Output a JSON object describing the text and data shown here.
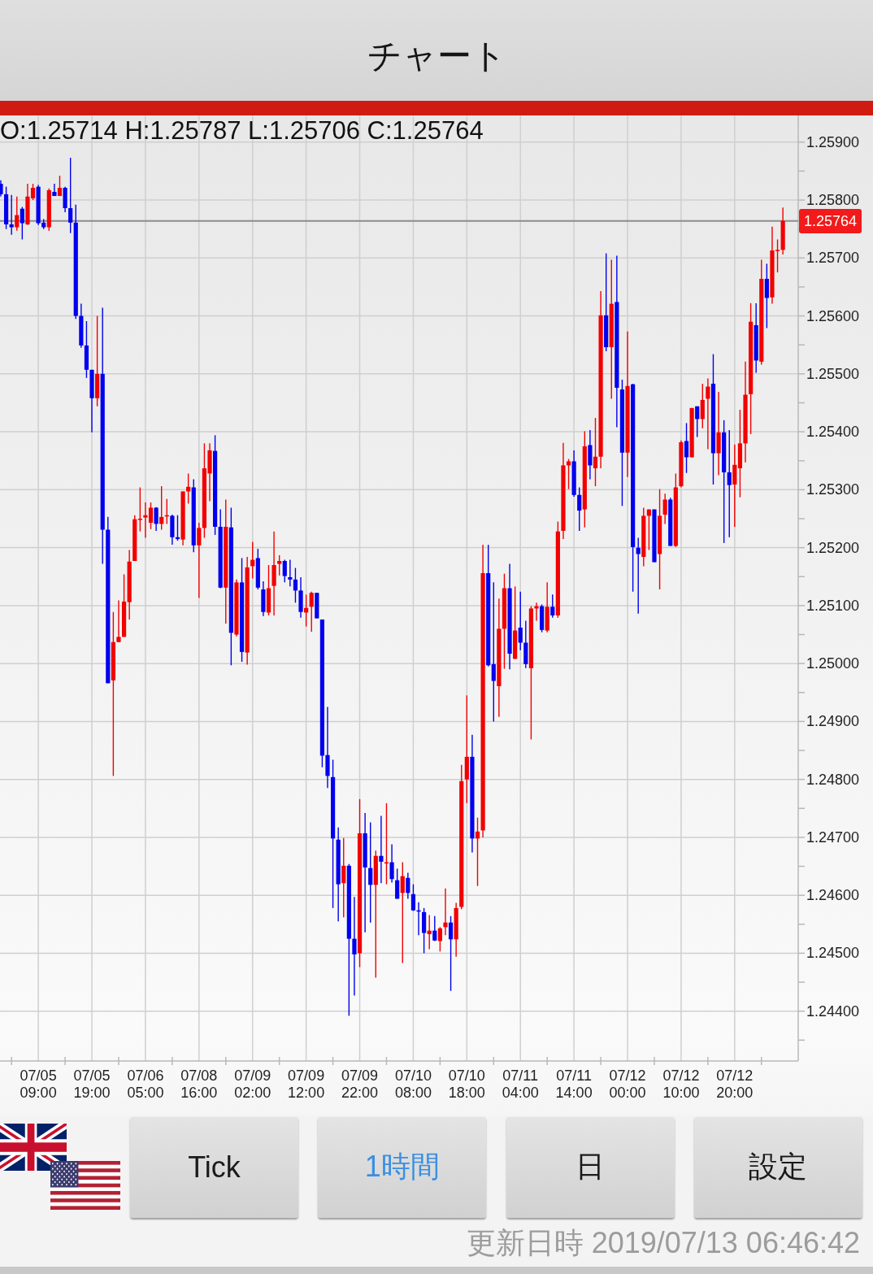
{
  "title_bar": {
    "title": "チャート"
  },
  "chart": {
    "ohlc_readout": "O:1.25714 H:1.25787 L:1.25706 C:1.25764",
    "chart_data": {
      "type": "candlestick",
      "grid": true,
      "ylim": [
        1.24314,
        1.25946
      ],
      "yticks": [
        {
          "value": 1.259,
          "label": "1.25900"
        },
        {
          "value": 1.258,
          "label": "1.25800"
        },
        {
          "value": 1.257,
          "label": "1.25700"
        },
        {
          "value": 1.256,
          "label": "1.25600"
        },
        {
          "value": 1.255,
          "label": "1.25500"
        },
        {
          "value": 1.254,
          "label": "1.25400"
        },
        {
          "value": 1.253,
          "label": "1.25300"
        },
        {
          "value": 1.252,
          "label": "1.25200"
        },
        {
          "value": 1.251,
          "label": "1.25100"
        },
        {
          "value": 1.25,
          "label": "1.25000"
        },
        {
          "value": 1.249,
          "label": "1.24900"
        },
        {
          "value": 1.248,
          "label": "1.24800"
        },
        {
          "value": 1.247,
          "label": "1.24700"
        },
        {
          "value": 1.246,
          "label": "1.24600"
        },
        {
          "value": 1.245,
          "label": "1.24500"
        },
        {
          "value": 1.244,
          "label": "1.24400"
        }
      ],
      "categories": [
        null,
        null,
        null,
        null,
        null,
        null,
        null,
        "07/05 09:00",
        null,
        null,
        null,
        null,
        null,
        null,
        null,
        null,
        null,
        "07/05 19:00",
        null,
        null,
        null,
        null,
        null,
        null,
        null,
        null,
        null,
        "07/06 05:00",
        null,
        null,
        null,
        null,
        null,
        null,
        null,
        null,
        null,
        "07/08 16:00",
        null,
        null,
        null,
        null,
        null,
        null,
        null,
        null,
        null,
        "07/09 02:00",
        null,
        null,
        null,
        null,
        null,
        null,
        null,
        null,
        null,
        "07/09 12:00",
        null,
        null,
        null,
        null,
        null,
        null,
        null,
        null,
        null,
        "07/09 22:00",
        null,
        null,
        null,
        null,
        null,
        null,
        null,
        null,
        null,
        "07/10 08:00",
        null,
        null,
        null,
        null,
        null,
        null,
        null,
        null,
        null,
        "07/10 18:00",
        null,
        null,
        null,
        null,
        null,
        null,
        null,
        null,
        null,
        "07/11 04:00",
        null,
        null,
        null,
        null,
        null,
        null,
        null,
        null,
        null,
        "07/11 14:00",
        null,
        null,
        null,
        null,
        null,
        null,
        null,
        null,
        null,
        "07/12 00:00",
        null,
        null,
        null,
        null,
        null,
        null,
        null,
        null,
        null,
        "07/12 10:00",
        null,
        null,
        null,
        null,
        null,
        null,
        null,
        null,
        null,
        "07/12 20:00",
        null,
        null,
        null,
        null,
        null,
        null,
        null,
        null,
        null
      ],
      "ohlc": [
        [
          1.25828,
          1.25834,
          1.25806,
          1.2581
        ],
        [
          1.2581,
          1.25823,
          1.2575,
          1.25758
        ],
        [
          1.25758,
          1.25809,
          1.2574,
          1.25753
        ],
        [
          1.25753,
          1.25806,
          1.25747,
          1.25774
        ],
        [
          1.25785,
          1.25788,
          1.25732,
          1.2576
        ],
        [
          1.25758,
          1.25828,
          1.25757,
          1.25806
        ],
        [
          1.25803,
          1.25828,
          1.258,
          1.25821
        ],
        [
          1.25823,
          1.25826,
          1.25757,
          1.2576
        ],
        [
          1.25761,
          1.25767,
          1.2575,
          1.25753
        ],
        [
          1.25753,
          1.2582,
          1.25747,
          1.25817
        ],
        [
          1.25814,
          1.25828,
          1.25807,
          1.25807
        ],
        [
          1.25807,
          1.25842,
          1.25807,
          1.25821
        ],
        [
          1.25821,
          1.25823,
          1.25779,
          1.25786
        ],
        [
          1.25786,
          1.25873,
          1.25743,
          1.25761
        ],
        [
          1.25761,
          1.25792,
          1.25595,
          1.256
        ],
        [
          1.256,
          1.25621,
          1.25545,
          1.25549
        ],
        [
          1.25549,
          1.25591,
          1.25493,
          1.25507
        ],
        [
          1.25507,
          1.25507,
          1.25399,
          1.25458
        ],
        [
          1.25458,
          1.256,
          1.25444,
          1.255
        ],
        [
          1.255,
          1.25614,
          1.25172,
          1.25231
        ],
        [
          1.25231,
          1.25253,
          1.24966,
          1.24966
        ],
        [
          1.24971,
          1.25089,
          1.24806,
          1.25037
        ],
        [
          1.25037,
          1.25109,
          1.25037,
          1.25046
        ],
        [
          1.25046,
          1.25154,
          1.25046,
          1.25107
        ],
        [
          1.25106,
          1.25196,
          1.25076,
          1.25176
        ],
        [
          1.25177,
          1.25256,
          1.25177,
          1.25249
        ],
        [
          1.25249,
          1.25304,
          1.25228,
          1.2525
        ],
        [
          1.25252,
          1.25278,
          1.25217,
          1.25256
        ],
        [
          1.25243,
          1.25278,
          1.25232,
          1.25269
        ],
        [
          1.25269,
          1.2527,
          1.25229,
          1.25241
        ],
        [
          1.25241,
          1.25306,
          1.25231,
          1.25253
        ],
        [
          1.25255,
          1.25284,
          1.25241,
          1.25256
        ],
        [
          1.25255,
          1.25257,
          1.25205,
          1.25218
        ],
        [
          1.25218,
          1.25256,
          1.25212,
          1.25215
        ],
        [
          1.25214,
          1.25297,
          1.25204,
          1.25297
        ],
        [
          1.25297,
          1.25328,
          1.25276,
          1.25305
        ],
        [
          1.25304,
          1.25318,
          1.25192,
          1.25204
        ],
        [
          1.25204,
          1.25243,
          1.25113,
          1.25234
        ],
        [
          1.25234,
          1.2538,
          1.25217,
          1.25337
        ],
        [
          1.25328,
          1.2538,
          1.2528,
          1.25368
        ],
        [
          1.25367,
          1.25394,
          1.25222,
          1.25236
        ],
        [
          1.25236,
          1.25266,
          1.2513,
          1.25131
        ],
        [
          1.25131,
          1.25283,
          1.25069,
          1.25236
        ],
        [
          1.25235,
          1.25269,
          1.24997,
          1.25053
        ],
        [
          1.2505,
          1.25145,
          1.25047,
          1.2514
        ],
        [
          1.2514,
          1.25182,
          1.25003,
          1.2502
        ],
        [
          1.25019,
          1.25184,
          1.24998,
          1.25166
        ],
        [
          1.25168,
          1.2521,
          1.25147,
          1.25179
        ],
        [
          1.25182,
          1.25198,
          1.25128,
          1.25131
        ],
        [
          1.25128,
          1.25142,
          1.25082,
          1.25089
        ],
        [
          1.25088,
          1.2517,
          1.25083,
          1.2513
        ],
        [
          1.25134,
          1.25228,
          1.25083,
          1.2517
        ],
        [
          1.25172,
          1.25187,
          1.25152,
          1.25177
        ],
        [
          1.25177,
          1.25179,
          1.2514,
          1.25151
        ],
        [
          1.25149,
          1.25179,
          1.25133,
          1.25145
        ],
        [
          1.25145,
          1.25165,
          1.25105,
          1.25126
        ],
        [
          1.25126,
          1.25149,
          1.25079,
          1.25089
        ],
        [
          1.25088,
          1.25119,
          1.25064,
          1.25096
        ],
        [
          1.25098,
          1.25124,
          1.25055,
          1.25122
        ],
        [
          1.25122,
          1.25122,
          1.25078,
          1.25078
        ],
        [
          1.25076,
          1.25076,
          1.24821,
          1.24841
        ],
        [
          1.24842,
          1.24925,
          1.24785,
          1.24806
        ],
        [
          1.24804,
          1.24834,
          1.24578,
          1.24698
        ],
        [
          1.24696,
          1.24717,
          1.24555,
          1.24619
        ],
        [
          1.24621,
          1.24699,
          1.24562,
          1.24651
        ],
        [
          1.24651,
          1.24654,
          1.24392,
          1.24525
        ],
        [
          1.24525,
          1.24597,
          1.24427,
          1.24498
        ],
        [
          1.245,
          1.24766,
          1.24476,
          1.24707
        ],
        [
          1.24707,
          1.24742,
          1.24536,
          1.24648
        ],
        [
          1.24647,
          1.24726,
          1.24553,
          1.24618
        ],
        [
          1.24618,
          1.24677,
          1.24458,
          1.24668
        ],
        [
          1.24668,
          1.24737,
          1.24621,
          1.24658
        ],
        [
          1.24656,
          1.24759,
          1.24619,
          1.24657
        ],
        [
          1.24657,
          1.24688,
          1.24622,
          1.24628
        ],
        [
          1.24626,
          1.24646,
          1.24594,
          1.24594
        ],
        [
          1.24604,
          1.24657,
          1.24483,
          1.24633
        ],
        [
          1.2463,
          1.24639,
          1.24594,
          1.24604
        ],
        [
          1.24602,
          1.24619,
          1.24573,
          1.24574
        ],
        [
          1.24574,
          1.24588,
          1.24531,
          1.24573
        ],
        [
          1.24571,
          1.24578,
          1.245,
          1.24535
        ],
        [
          1.24533,
          1.24566,
          1.24507,
          1.24539
        ],
        [
          1.24539,
          1.24564,
          1.24521,
          1.24522
        ],
        [
          1.24521,
          1.24545,
          1.24503,
          1.24543
        ],
        [
          1.24545,
          1.24612,
          1.24531,
          1.24553
        ],
        [
          1.24553,
          1.24564,
          1.24435,
          1.24524
        ],
        [
          1.24524,
          1.24587,
          1.24494,
          1.24578
        ],
        [
          1.2458,
          1.24825,
          1.24576,
          1.24797
        ],
        [
          1.248,
          1.24945,
          1.24759,
          1.24839
        ],
        [
          1.24839,
          1.24877,
          1.24674,
          1.24698
        ],
        [
          1.24698,
          1.24734,
          1.24616,
          1.2471
        ],
        [
          1.24712,
          1.25205,
          1.247,
          1.25156
        ],
        [
          1.25156,
          1.25205,
          1.24995,
          1.24997
        ],
        [
          1.24999,
          1.2514,
          1.249,
          1.2497
        ],
        [
          1.24961,
          1.25112,
          1.24908,
          1.2506
        ],
        [
          1.2506,
          1.25155,
          1.24991,
          1.2513
        ],
        [
          1.2513,
          1.25172,
          1.2499,
          1.25017
        ],
        [
          1.25008,
          1.25133,
          1.25008,
          1.25057
        ],
        [
          1.25062,
          1.25124,
          1.25023,
          1.25036
        ],
        [
          1.25036,
          1.25074,
          1.24992,
          1.24999
        ],
        [
          1.24992,
          1.25099,
          1.24869,
          1.25095
        ],
        [
          1.25095,
          1.25105,
          1.25074,
          1.25099
        ],
        [
          1.25099,
          1.25102,
          1.25054,
          1.25058
        ],
        [
          1.25057,
          1.2514,
          1.25054,
          1.25098
        ],
        [
          1.25098,
          1.25119,
          1.25079,
          1.25083
        ],
        [
          1.25083,
          1.25245,
          1.25079,
          1.25228
        ],
        [
          1.25229,
          1.25381,
          1.25215,
          1.25342
        ],
        [
          1.25342,
          1.25353,
          1.25301,
          1.25349
        ],
        [
          1.25349,
          1.25368,
          1.25288,
          1.25291
        ],
        [
          1.25291,
          1.25304,
          1.25229,
          1.25264
        ],
        [
          1.25266,
          1.25401,
          1.25235,
          1.25375
        ],
        [
          1.25377,
          1.25403,
          1.25318,
          1.25342
        ],
        [
          1.25337,
          1.25424,
          1.25306,
          1.25357
        ],
        [
          1.25357,
          1.25643,
          1.25337,
          1.25601
        ],
        [
          1.25601,
          1.25708,
          1.25539,
          1.25546
        ],
        [
          1.25546,
          1.25697,
          1.25457,
          1.25621
        ],
        [
          1.25624,
          1.25704,
          1.25408,
          1.25476
        ],
        [
          1.25473,
          1.2549,
          1.25272,
          1.25364
        ],
        [
          1.25364,
          1.25573,
          1.25322,
          1.25479
        ],
        [
          1.25482,
          1.25483,
          1.25124,
          1.25201
        ],
        [
          1.252,
          1.25217,
          1.25086,
          1.25189
        ],
        [
          1.25184,
          1.25269,
          1.25168,
          1.25255
        ],
        [
          1.25255,
          1.25266,
          1.25196,
          1.25266
        ],
        [
          1.25266,
          1.25266,
          1.25175,
          1.25175
        ],
        [
          1.25189,
          1.25301,
          1.25128,
          1.25255
        ],
        [
          1.25257,
          1.25293,
          1.25241,
          1.25283
        ],
        [
          1.25283,
          1.25286,
          1.25203,
          1.25203
        ],
        [
          1.25203,
          1.25328,
          1.25201,
          1.25304
        ],
        [
          1.25306,
          1.25385,
          1.25304,
          1.25382
        ],
        [
          1.25384,
          1.25415,
          1.25329,
          1.25356
        ],
        [
          1.25356,
          1.25441,
          1.25356,
          1.25441
        ],
        [
          1.25444,
          1.25444,
          1.25391,
          1.25422
        ],
        [
          1.25422,
          1.25483,
          1.25406,
          1.25455
        ],
        [
          1.25457,
          1.25492,
          1.2537,
          1.25478
        ],
        [
          1.25483,
          1.25534,
          1.25309,
          1.25363
        ],
        [
          1.25363,
          1.25469,
          1.25325,
          1.25399
        ],
        [
          1.25399,
          1.2542,
          1.25208,
          1.2533
        ],
        [
          1.2533,
          1.25403,
          1.25218,
          1.25308
        ],
        [
          1.25309,
          1.25378,
          1.25236,
          1.25343
        ],
        [
          1.25337,
          1.25438,
          1.25287,
          1.2538
        ],
        [
          1.2538,
          1.25521,
          1.25347,
          1.25464
        ],
        [
          1.25465,
          1.25622,
          1.25396,
          1.2559
        ],
        [
          1.25584,
          1.25622,
          1.25502,
          1.25523
        ],
        [
          1.25521,
          1.25697,
          1.25516,
          1.25664
        ],
        [
          1.25664,
          1.2569,
          1.25579,
          1.25631
        ],
        [
          1.25632,
          1.25754,
          1.25621,
          1.25713
        ],
        [
          1.25713,
          1.25732,
          1.25675,
          1.25714
        ],
        [
          1.25714,
          1.25787,
          1.25706,
          1.25764
        ]
      ],
      "ref_lines": [
        {
          "axis": "y",
          "value": 1.25764,
          "label": "1.25764"
        }
      ]
    }
  },
  "buttons": [
    {
      "label": "Tick",
      "selected": false
    },
    {
      "label": "1時間",
      "selected": true
    },
    {
      "label": "日",
      "selected": false
    },
    {
      "label": "設定",
      "selected": false
    }
  ],
  "updated_at": "更新日時 2019/07/13 06:46:42"
}
